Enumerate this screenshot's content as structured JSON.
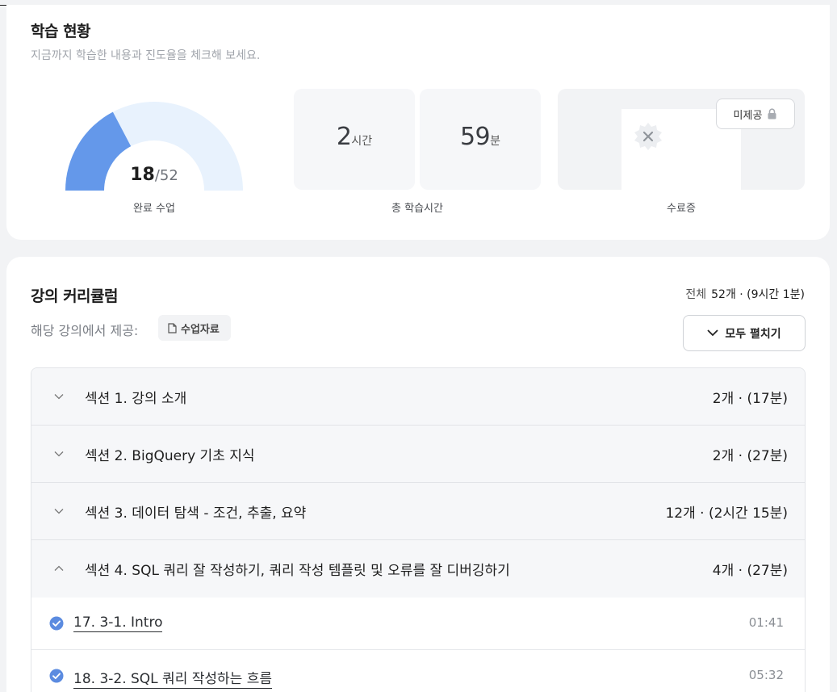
{
  "status": {
    "title": "학습 현황",
    "subtitle": "지금까지 학습한 내용과 진도율을 체크해 보세요.",
    "completed": {
      "done": "18",
      "total": "/52",
      "label": "완료 수업",
      "progress": 0.346
    },
    "study_time": {
      "hours": "2",
      "hours_unit": "시간",
      "minutes": "59",
      "minutes_unit": "분",
      "label": "총 학습시간"
    },
    "certificate": {
      "badge": "미제공",
      "label": "수료증",
      "lock_icon": "lock-icon"
    },
    "colors": {
      "gauge_fill": "#6498ea",
      "gauge_track": "#e8f2fd"
    }
  },
  "curriculum": {
    "title": "강의 커리큘럼",
    "total_label": "전체",
    "total_value": "52개 · (9시간 1분)",
    "provided_label": "해당 강의에서 제공:",
    "material_chip": "수업자료",
    "expand_all": "모두 펼치기",
    "sections": [
      {
        "name": "섹션 1. 강의 소개",
        "meta": "2개 · (17분)",
        "expanded": false
      },
      {
        "name": "섹션 2. BigQuery 기초 지식",
        "meta": "2개 · (27분)",
        "expanded": false
      },
      {
        "name": "섹션 3. 데이터 탐색 - 조건, 추출, 요약",
        "meta": "12개 · (2시간 15분)",
        "expanded": false
      },
      {
        "name": "섹션 4. SQL 쿼리 잘 작성하기, 쿼리 작성 템플릿 및 오류를 잘 디버깅하기",
        "meta": "4개 · (27분)",
        "expanded": true
      }
    ],
    "lessons": [
      {
        "title": "17. 3-1. Intro",
        "duration": "01:41",
        "completed": true
      },
      {
        "title": "18. 3-2. SQL 쿼리 작성하는 흐름",
        "duration": "05:32",
        "completed": true
      }
    ],
    "colors": {
      "check": "#5b8be0"
    }
  }
}
